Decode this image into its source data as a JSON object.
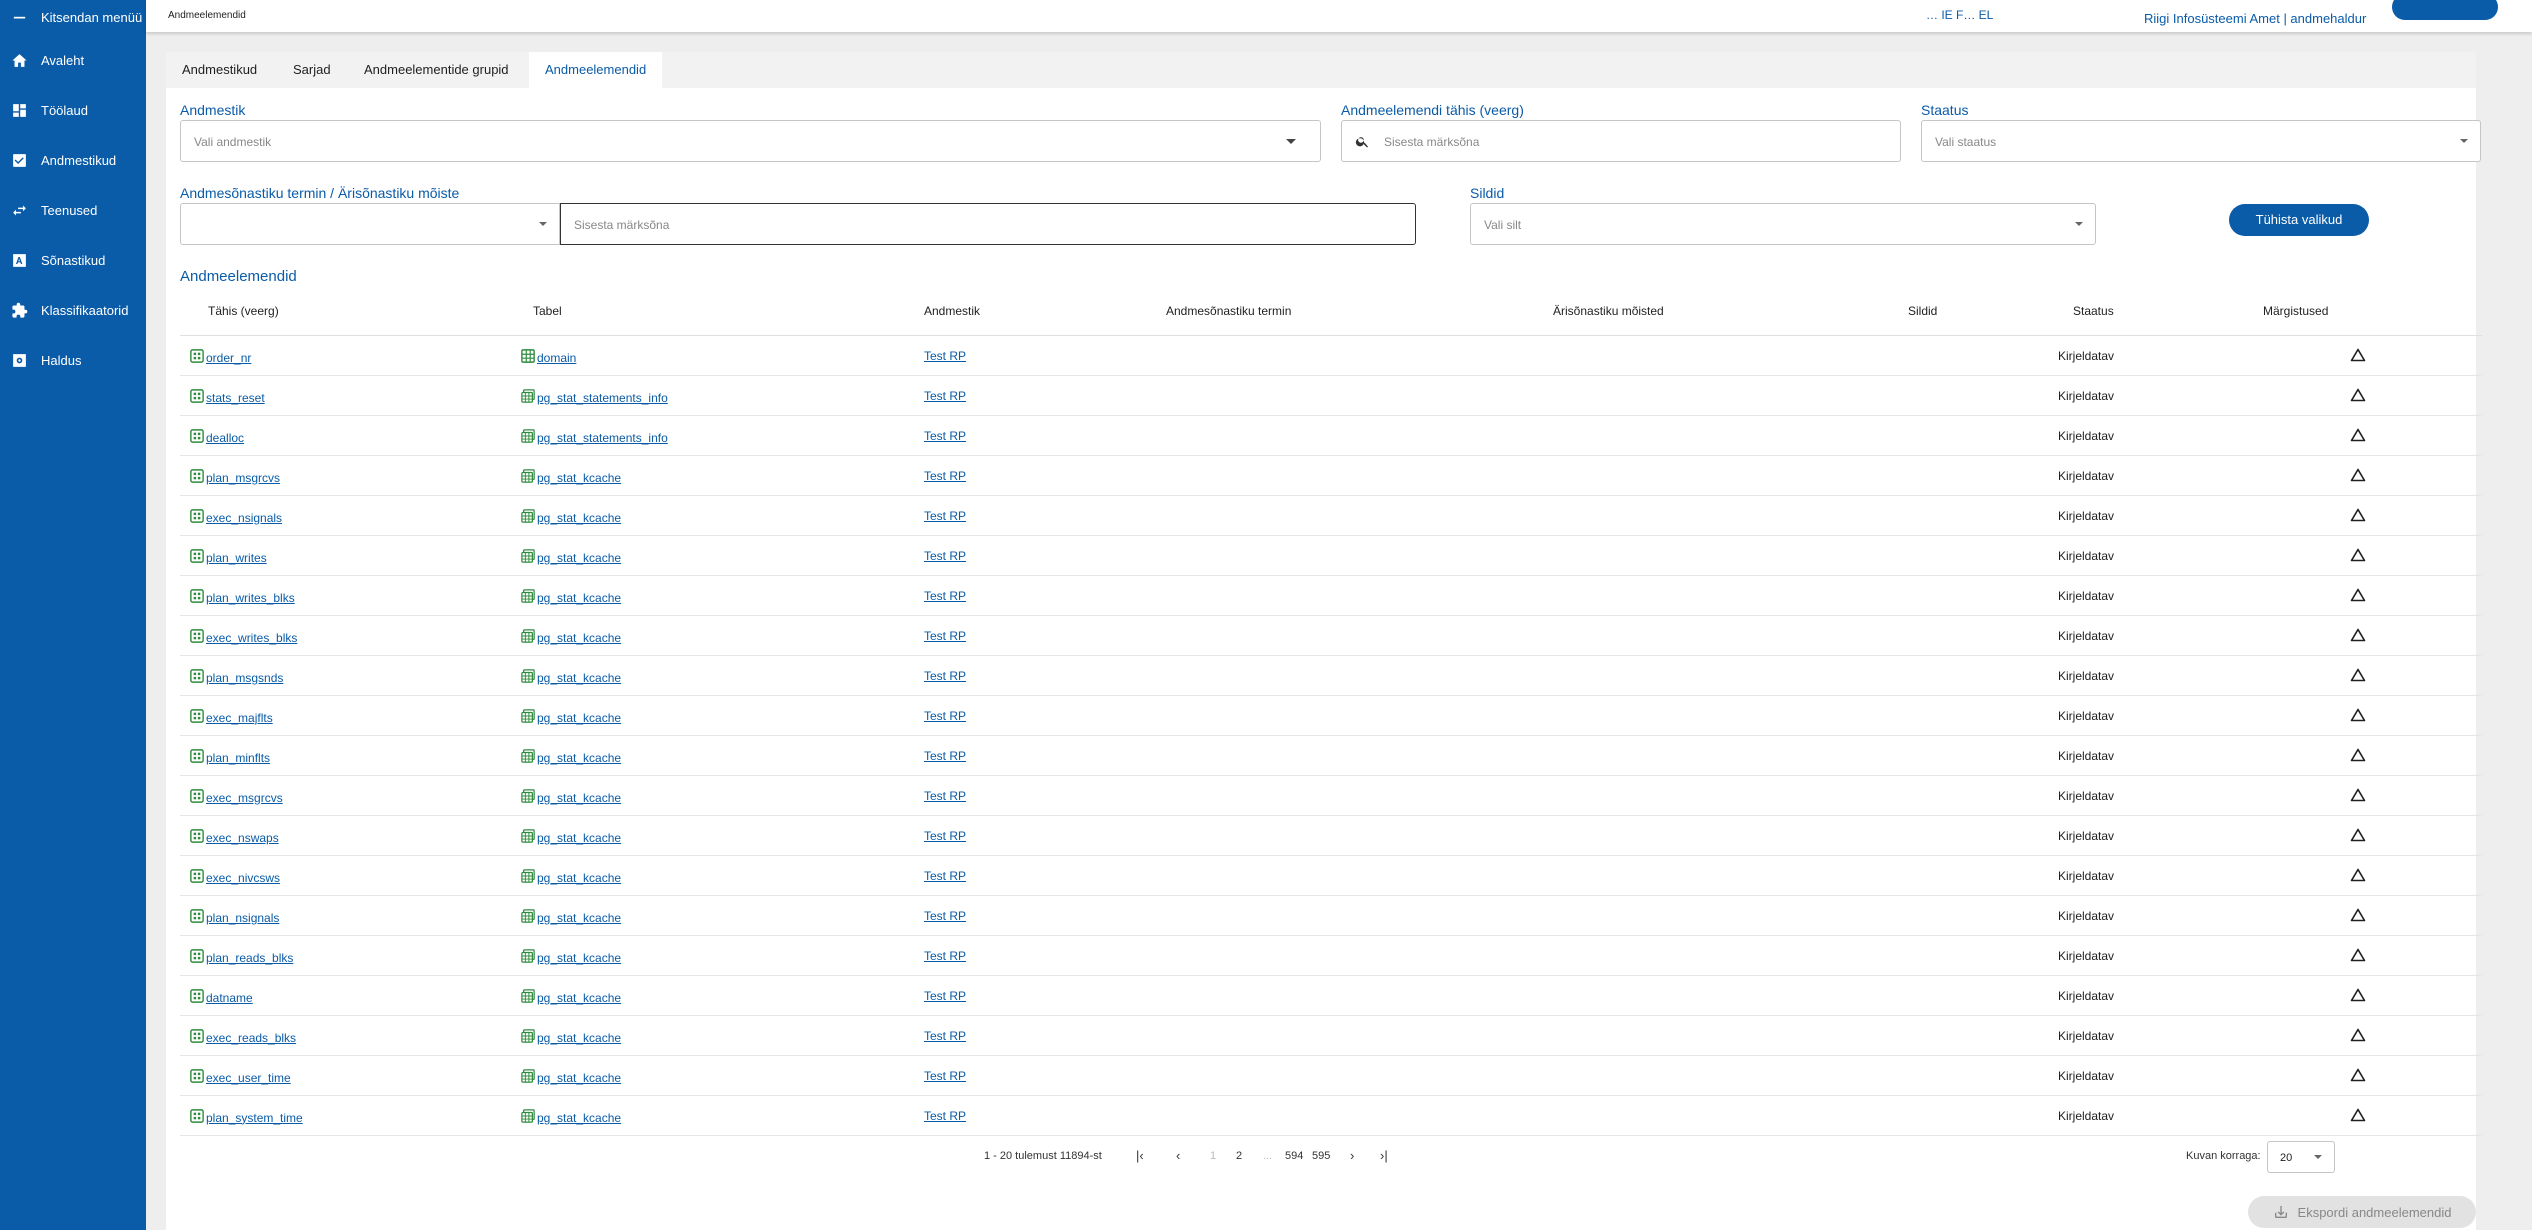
{
  "sidebar": {
    "collapse_label": "Kitsendan menüü",
    "items": [
      {
        "label": "Avaleht",
        "icon": "home-icon"
      },
      {
        "label": "Töölaud",
        "icon": "dashboard-icon"
      },
      {
        "label": "Andmestikud",
        "icon": "checkbox-icon"
      },
      {
        "label": "Teenused",
        "icon": "swap-icon"
      },
      {
        "label": "Sõnastikud",
        "icon": "dictionary-icon"
      },
      {
        "label": "Klassifikaatorid",
        "icon": "puzzle-icon"
      },
      {
        "label": "Haldus",
        "icon": "settings-icon"
      }
    ]
  },
  "topbar": {
    "breadcrumb": "Andmeelemendid",
    "logo_text": "… IE F… EL",
    "user": "Riigi Infosüsteemi Amet | andmehaldur"
  },
  "tabs": [
    "Andmestikud",
    "Sarjad",
    "Andmeelementide grupid",
    "Andmeelemendid"
  ],
  "active_tab": "Andmeelemendid",
  "filters": {
    "dataset_label": "Andmestik",
    "dataset_placeholder": "Vali andmestik",
    "element_label": "Andmeelemendi tähis (veerg)",
    "element_placeholder": "Sisesta märksõna",
    "status_label": "Staatus",
    "status_placeholder": "Vali staatus",
    "term_label": "Andmesõnastiku termin / Ärisõnastiku mõiste",
    "term_value": "",
    "term_placeholder": "Sisesta märksõna",
    "tags_label": "Sildid",
    "tags_placeholder": "Vali silt",
    "clear_button": "Tühista valikud"
  },
  "table": {
    "title": "Andmeelemendid",
    "columns": [
      "Tähis (veerg)",
      "Tabel",
      "Andmestik",
      "Andmesõnastiku termin",
      "Ärisõnastiku mõisted",
      "Sildid",
      "Staatus",
      "Märgistused"
    ],
    "rows": [
      {
        "name": "order_nr",
        "table": "domain",
        "dataset": "Test RP",
        "status": "Kirjeldatav",
        "table_icon": "grid"
      },
      {
        "name": "stats_reset",
        "table": "pg_stat_statements_info",
        "dataset": "Test RP",
        "status": "Kirjeldatav",
        "table_icon": "view"
      },
      {
        "name": "dealloc",
        "table": "pg_stat_statements_info",
        "dataset": "Test RP",
        "status": "Kirjeldatav",
        "table_icon": "view"
      },
      {
        "name": "plan_msgrcvs",
        "table": "pg_stat_kcache",
        "dataset": "Test RP",
        "status": "Kirjeldatav",
        "table_icon": "view"
      },
      {
        "name": "exec_nsignals",
        "table": "pg_stat_kcache",
        "dataset": "Test RP",
        "status": "Kirjeldatav",
        "table_icon": "view"
      },
      {
        "name": "plan_writes",
        "table": "pg_stat_kcache",
        "dataset": "Test RP",
        "status": "Kirjeldatav",
        "table_icon": "view"
      },
      {
        "name": "plan_writes_blks",
        "table": "pg_stat_kcache",
        "dataset": "Test RP",
        "status": "Kirjeldatav",
        "table_icon": "view"
      },
      {
        "name": "exec_writes_blks",
        "table": "pg_stat_kcache",
        "dataset": "Test RP",
        "status": "Kirjeldatav",
        "table_icon": "view"
      },
      {
        "name": "plan_msgsnds",
        "table": "pg_stat_kcache",
        "dataset": "Test RP",
        "status": "Kirjeldatav",
        "table_icon": "view"
      },
      {
        "name": "exec_majflts",
        "table": "pg_stat_kcache",
        "dataset": "Test RP",
        "status": "Kirjeldatav",
        "table_icon": "view"
      },
      {
        "name": "plan_minflts",
        "table": "pg_stat_kcache",
        "dataset": "Test RP",
        "status": "Kirjeldatav",
        "table_icon": "view"
      },
      {
        "name": "exec_msgrcvs",
        "table": "pg_stat_kcache",
        "dataset": "Test RP",
        "status": "Kirjeldatav",
        "table_icon": "view"
      },
      {
        "name": "exec_nswaps",
        "table": "pg_stat_kcache",
        "dataset": "Test RP",
        "status": "Kirjeldatav",
        "table_icon": "view"
      },
      {
        "name": "exec_nivcsws",
        "table": "pg_stat_kcache",
        "dataset": "Test RP",
        "status": "Kirjeldatav",
        "table_icon": "view"
      },
      {
        "name": "plan_nsignals",
        "table": "pg_stat_kcache",
        "dataset": "Test RP",
        "status": "Kirjeldatav",
        "table_icon": "view"
      },
      {
        "name": "plan_reads_blks",
        "table": "pg_stat_kcache",
        "dataset": "Test RP",
        "status": "Kirjeldatav",
        "table_icon": "view"
      },
      {
        "name": "datname",
        "table": "pg_stat_kcache",
        "dataset": "Test RP",
        "status": "Kirjeldatav",
        "table_icon": "view"
      },
      {
        "name": "exec_reads_blks",
        "table": "pg_stat_kcache",
        "dataset": "Test RP",
        "status": "Kirjeldatav",
        "table_icon": "view"
      },
      {
        "name": "exec_user_time",
        "table": "pg_stat_kcache",
        "dataset": "Test RP",
        "status": "Kirjeldatav",
        "table_icon": "view"
      },
      {
        "name": "plan_system_time",
        "table": "pg_stat_kcache",
        "dataset": "Test RP",
        "status": "Kirjeldatav",
        "table_icon": "view"
      }
    ]
  },
  "pagination": {
    "range_text": "1 - 20 tulemust 11894-st",
    "pages": [
      "1",
      "2",
      "...",
      "594",
      "595"
    ],
    "current_page": "1",
    "per_page_label": "Kuvan korraga:",
    "per_page": "20"
  },
  "export_button": "Ekspordi andmeelemendid",
  "colors": {
    "primary": "#0a5ba8",
    "icon_green": "#2e8b3d"
  }
}
